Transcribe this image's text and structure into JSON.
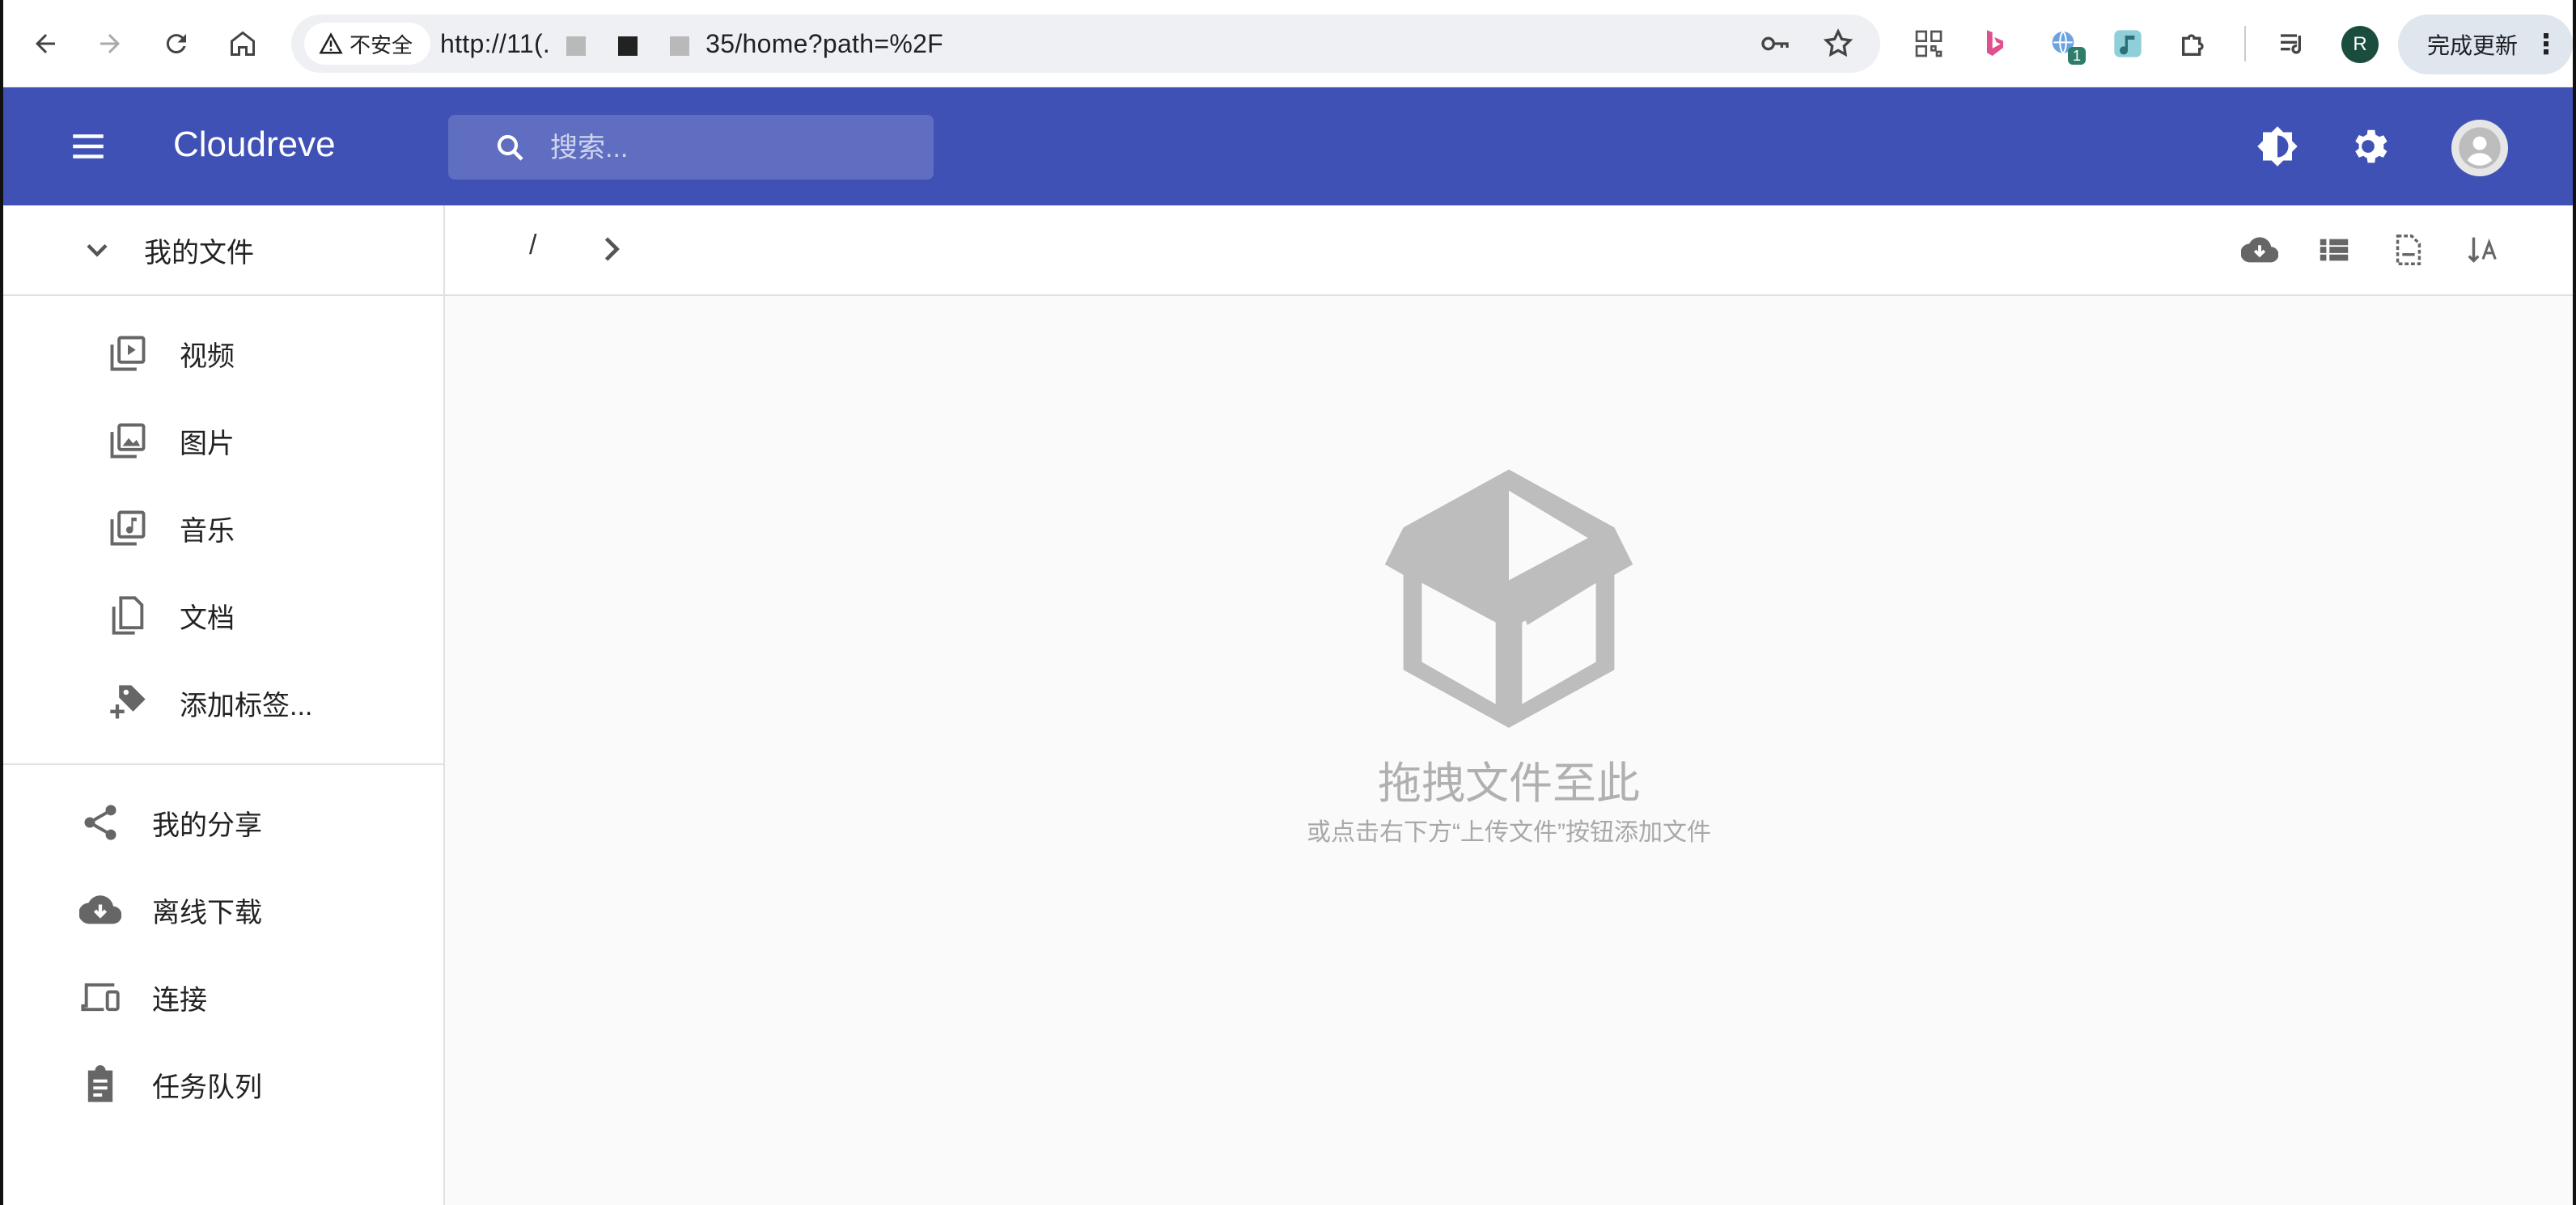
{
  "browser": {
    "security_label": "不安全",
    "url_prefix": "http://11(.",
    "url_suffix": "35/home?path=%2F",
    "extension_badge": "1",
    "profile_initial": "R",
    "update_button": "完成更新"
  },
  "app": {
    "title": "Cloudreve",
    "search_placeholder": "搜索...",
    "primary_color": "#3f51b5"
  },
  "sidebar": {
    "header": "我的文件",
    "sub_items": [
      {
        "label": "视频",
        "icon": "video-library-icon"
      },
      {
        "label": "图片",
        "icon": "photo-library-icon"
      },
      {
        "label": "音乐",
        "icon": "music-library-icon"
      },
      {
        "label": "文档",
        "icon": "documents-icon"
      },
      {
        "label": "添加标签...",
        "icon": "add-tag-icon"
      }
    ],
    "items": [
      {
        "label": "我的分享",
        "icon": "share-icon"
      },
      {
        "label": "离线下载",
        "icon": "cloud-download-icon"
      },
      {
        "label": "连接",
        "icon": "devices-icon"
      },
      {
        "label": "任务队列",
        "icon": "clipboard-icon"
      }
    ]
  },
  "toolbar": {
    "breadcrumb_root": "/"
  },
  "empty_state": {
    "title": "拖拽文件至此",
    "subtitle": "或点击右下方“上传文件”按钮添加文件"
  }
}
